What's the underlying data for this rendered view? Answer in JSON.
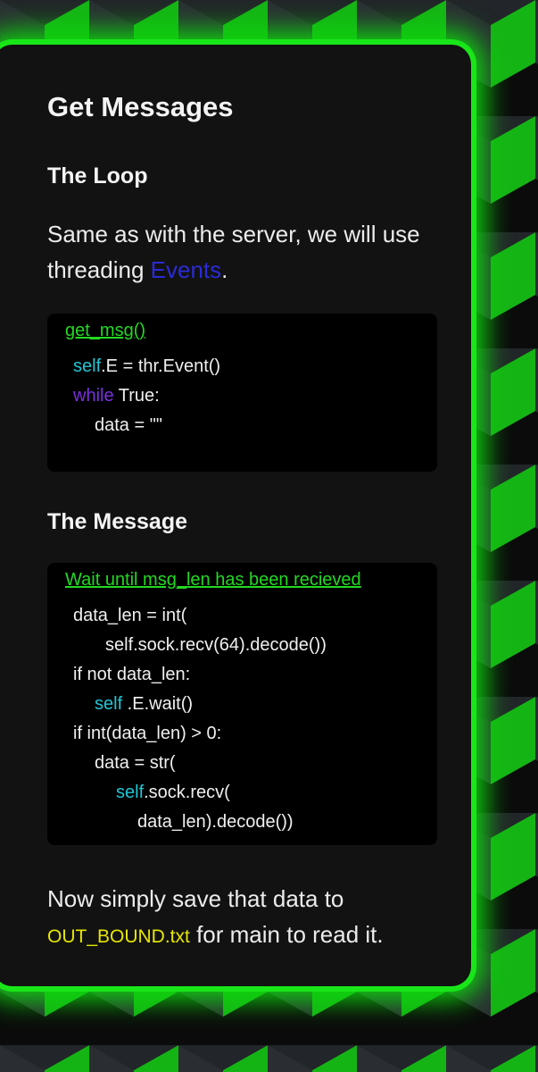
{
  "heading": "Get Messages",
  "loop_section": {
    "title": "The Loop",
    "text_before": "Same as with the server, we will use threading ",
    "link": "Events",
    "text_after": ".",
    "code_title": "get_msg()",
    "code": {
      "line1_kw": "self",
      "line1_rest": ".E = thr.Event()",
      "line2_kw": "while",
      "line2_rest": " True:",
      "line3": "data = \"\""
    }
  },
  "message_section": {
    "title": "The Message",
    "code_title": "Wait until msg_len has been recieved",
    "code": {
      "l1": "data_len = int(",
      "l2": "self.sock.recv(64).decode())",
      "l3": "if not data_len:",
      "l4_kw": "self",
      "l4_rest": " .E.wait()",
      "l5": "if int(data_len) > 0:",
      "l6": "data = str(",
      "l7_kw": "self",
      "l7_rest": ".sock.recv(",
      "l8": "data_len).decode())"
    }
  },
  "closing": {
    "text_before": "Now simply save that data to ",
    "filename": "OUT_BOUND.txt",
    "text_after": " for main to read it."
  },
  "colors": {
    "accent_green": "#19e619",
    "link_blue": "#2b2bd6",
    "filename_yellow": "#e6e600",
    "keyword_cyan": "#1fc6d6",
    "keyword_purple": "#7b2fe0"
  }
}
